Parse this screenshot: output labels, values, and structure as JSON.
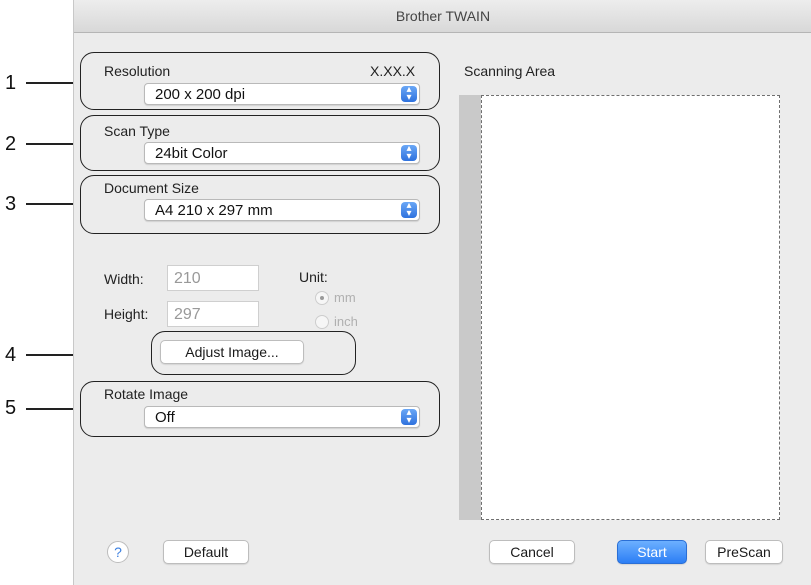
{
  "window": {
    "title": "Brother TWAIN"
  },
  "callouts": [
    "1",
    "2",
    "3",
    "4",
    "5"
  ],
  "resolution": {
    "label": "Resolution",
    "version": "X.XX.X",
    "value": "200 x 200 dpi"
  },
  "scan_type": {
    "label": "Scan Type",
    "value": "24bit Color"
  },
  "document_size": {
    "label": "Document Size",
    "value": "A4  210 x 297 mm"
  },
  "dimensions": {
    "width_label": "Width:",
    "width_value": "210",
    "height_label": "Height:",
    "height_value": "297",
    "unit_label": "Unit:",
    "unit_options": [
      "mm",
      "inch"
    ],
    "unit_selected": "mm"
  },
  "adjust_image": {
    "label": "Adjust Image..."
  },
  "rotate_image": {
    "label": "Rotate Image",
    "value": "Off"
  },
  "scanning_area": {
    "label": "Scanning Area"
  },
  "buttons": {
    "help": "?",
    "default": "Default",
    "cancel": "Cancel",
    "start": "Start",
    "prescan": "PreScan"
  },
  "colors": {
    "accent": "#2c7ef5",
    "window_bg": "#ececec"
  }
}
